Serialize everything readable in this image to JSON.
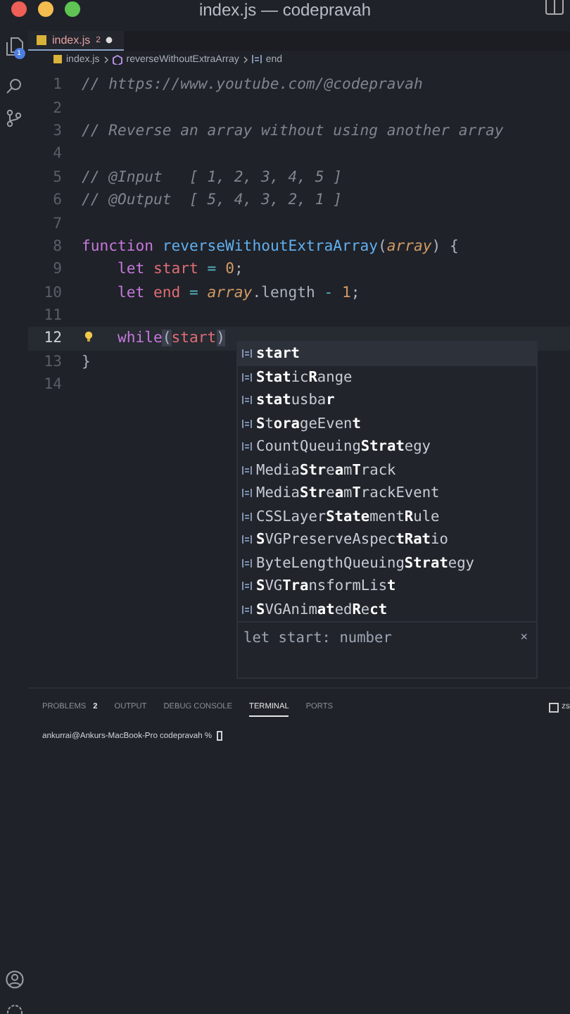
{
  "window": {
    "title": "index.js — codepravah"
  },
  "activity_bar": {
    "badge": "1"
  },
  "tabs": [
    {
      "label": "index.js",
      "problems": "2",
      "modified": true,
      "selected": true
    }
  ],
  "breadcrumb": [
    "index.js",
    "reverseWithoutExtraArray",
    "end"
  ],
  "editor": {
    "lines": [
      {
        "number": "1",
        "current": false,
        "tokens": [
          {
            "kind": "comment",
            "t": "// https://www.youtube.com/@codepravah"
          }
        ]
      },
      {
        "number": "2",
        "current": false
      },
      {
        "number": "3",
        "current": false,
        "tokens": [
          {
            "kind": "comment",
            "t": "// Reverse an array without using another array"
          }
        ]
      },
      {
        "number": "4",
        "current": false
      },
      {
        "number": "5",
        "current": false,
        "tokens": [
          {
            "kind": "comment",
            "t": "// @Input   [ 1, 2, 3, 4, 5 ]"
          }
        ]
      },
      {
        "number": "6",
        "current": false,
        "tokens": [
          {
            "kind": "comment",
            "t": "// @Output  [ 5, 4, 3, 2, 1 ]"
          }
        ]
      },
      {
        "number": "7",
        "current": false
      },
      {
        "number": "8",
        "current": false,
        "tokens": [
          {
            "kind": "keyword",
            "t": "function"
          },
          {
            "kind": "fn",
            "t": " reverseWithoutExtraArray"
          },
          {
            "kind": "punct",
            "t": "("
          },
          {
            "kind": "param",
            "t": "array"
          },
          {
            "kind": "punct",
            "t": ") {"
          }
        ]
      },
      {
        "number": "9",
        "current": false,
        "indented": true,
        "tokens": [
          {
            "kind": "keyword",
            "t": "let"
          },
          {
            "kind": "var",
            "t": " start"
          },
          {
            "kind": "op",
            "t": " = "
          },
          {
            "kind": "num",
            "t": "0"
          },
          {
            "kind": "punct",
            "t": ";"
          }
        ]
      },
      {
        "number": "10",
        "current": false,
        "indented": true,
        "tokens": [
          {
            "kind": "keyword",
            "t": "let"
          },
          {
            "kind": "var",
            "t": " end"
          },
          {
            "kind": "op",
            "t": " = "
          },
          {
            "kind": "param",
            "t": "array"
          },
          {
            "kind": "punct",
            "t": ".length"
          },
          {
            "kind": "op",
            "t": " - "
          },
          {
            "kind": "num",
            "t": "1"
          },
          {
            "kind": "punct",
            "t": ";"
          }
        ]
      },
      {
        "number": "11",
        "current": false
      },
      {
        "number": "12",
        "current": true,
        "lightbulb": true,
        "indented": true,
        "tokens": [
          {
            "kind": "keyword",
            "t": "while"
          },
          {
            "kind": "bracket",
            "t": "("
          },
          {
            "kind": "var",
            "t": "start"
          },
          {
            "kind": "bracket",
            "t": ")"
          }
        ]
      },
      {
        "number": "13",
        "current": false,
        "tokens": [
          {
            "kind": "punct",
            "t": "}"
          }
        ]
      },
      {
        "number": "14",
        "current": false
      }
    ]
  },
  "suggestions": {
    "items": [
      {
        "label": "**start**",
        "selected": true
      },
      {
        "label": "**Stat**ic**R**ange",
        "selected": false
      },
      {
        "label": "**stat**usba**r**",
        "selected": false
      },
      {
        "label": "**S**t**ora**geEven**t**",
        "selected": false
      },
      {
        "label": "CountQueuing**Strat**egy",
        "selected": false
      },
      {
        "label": "Media**Str**e**a**m**T**rack",
        "selected": false
      },
      {
        "label": "Media**Str**e**a**m**T**rackEvent",
        "selected": false
      },
      {
        "label": "CSSLayer**State**ment**R**ule",
        "selected": false
      },
      {
        "label": "**S**VGPreserveAspec**tRat**io",
        "selected": false
      },
      {
        "label": "ByteLengthQueuing**Strat**egy",
        "selected": false
      },
      {
        "label": "**S**VG**Tra**nsformLis**t**",
        "selected": false
      },
      {
        "label": "**S**VGAnim**at**ed**R**e**ct**",
        "selected": false
      }
    ],
    "detail": "let start: number",
    "close": "×"
  },
  "panel": {
    "tabs": [
      {
        "label": "PROBLEMS",
        "count": "2",
        "selected": false
      },
      {
        "label": "OUTPUT",
        "selected": false
      },
      {
        "label": "DEBUG CONSOLE",
        "selected": false
      },
      {
        "label": "TERMINAL",
        "selected": true
      },
      {
        "label": "PORTS",
        "selected": false
      }
    ],
    "shell": "zs",
    "prompt": "ankurrai@Ankurs-MacBook-Pro codepravah %"
  }
}
